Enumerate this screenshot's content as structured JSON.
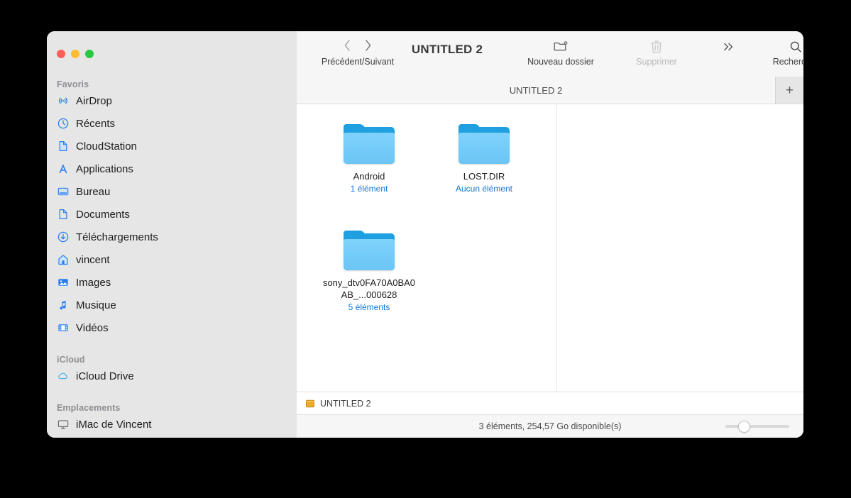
{
  "window": {
    "title": "UNTITLED 2",
    "traffic_lights": [
      {
        "name": "close",
        "color": "#ff5f57"
      },
      {
        "name": "minimize",
        "color": "#febc2e"
      },
      {
        "name": "zoom",
        "color": "#28c840"
      }
    ]
  },
  "toolbar": {
    "nav_caption": "Précédent/Suivant",
    "back_icon": "chevron-left-icon",
    "forward_icon": "chevron-right-icon",
    "new_folder": {
      "label": "Nouveau dossier",
      "icon": "new-folder-icon",
      "disabled": false
    },
    "delete": {
      "label": "Supprimer",
      "icon": "trash-icon",
      "disabled": true
    },
    "more": {
      "label": "",
      "icon": "chevron-double-right-icon",
      "disabled": false
    },
    "search": {
      "label": "Rechercher",
      "icon": "search-icon",
      "disabled": false
    }
  },
  "tab_bar": {
    "tabs": [
      {
        "label": "UNTITLED 2",
        "active": true
      }
    ],
    "new_tab_label": "+"
  },
  "sidebar": {
    "sections": [
      {
        "title": "Favoris",
        "items": [
          {
            "label": "AirDrop",
            "icon": "airdrop-icon"
          },
          {
            "label": "Récents",
            "icon": "clock-icon"
          },
          {
            "label": "CloudStation",
            "icon": "document-icon"
          },
          {
            "label": "Applications",
            "icon": "app-store-icon"
          },
          {
            "label": "Bureau",
            "icon": "desktop-icon"
          },
          {
            "label": "Documents",
            "icon": "document-icon"
          },
          {
            "label": "Téléchargements",
            "icon": "download-icon"
          },
          {
            "label": "vincent",
            "icon": "home-icon"
          },
          {
            "label": "Images",
            "icon": "photos-icon"
          },
          {
            "label": "Musique",
            "icon": "music-note-icon"
          },
          {
            "label": "Vidéos",
            "icon": "film-icon"
          }
        ]
      },
      {
        "title": "iCloud",
        "items": [
          {
            "label": "iCloud Drive",
            "icon": "cloud-icon"
          }
        ]
      },
      {
        "title": "Emplacements",
        "items": [
          {
            "label": "iMac de Vincent",
            "icon": "imac-display-icon"
          }
        ]
      }
    ]
  },
  "content": {
    "files": [
      {
        "name": "Android",
        "subtitle": "1 élément",
        "icon": "folder-icon"
      },
      {
        "name": "LOST.DIR",
        "subtitle": "Aucun élément",
        "icon": "folder-icon"
      },
      {
        "name": "sony_dtv0FA70A0BA0AB_...000628",
        "subtitle": "5 éléments",
        "icon": "folder-icon"
      }
    ]
  },
  "path_bar": {
    "drive_icon": "external-drive-icon",
    "label": "UNTITLED 2"
  },
  "status_bar": {
    "text": "3 éléments, 254,57 Go disponible(s)",
    "slider_name": "icon-size-slider"
  },
  "colors": {
    "sidebar_bg": "#e6e6e7",
    "toolbar_bg": "#f6f6f7",
    "accent_blue": "#1277d4",
    "icon_blue": "#2b7ef2",
    "folder_light": "#72cbf8",
    "folder_dark": "#1e9fe0"
  }
}
